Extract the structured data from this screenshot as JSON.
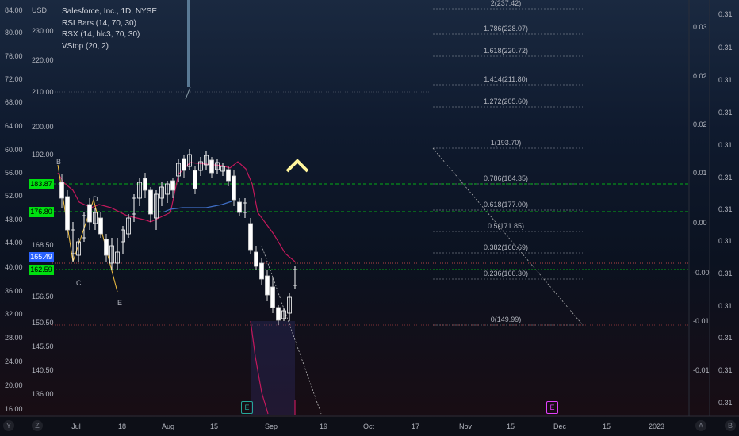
{
  "header": {
    "currency": "USD"
  },
  "legend": {
    "title": "Salesforce, Inc., 1D, NYSE",
    "indicators": [
      "RSI Bars (14, 70, 30)",
      "RSX (14, hlc3, 70, 30)",
      "VStop (20, 2)"
    ]
  },
  "left_scale": [
    "84.00",
    "80.00",
    "76.00",
    "72.00",
    "68.00",
    "64.00",
    "60.00",
    "56.00",
    "52.00",
    "48.00",
    "44.00",
    "40.00",
    "36.00",
    "32.00",
    "28.00",
    "24.00",
    "20.00",
    "16.00"
  ],
  "price_scale": [
    "230.00",
    "220.00",
    "210.00",
    "200.00",
    "192.00",
    "168.50",
    "156.50",
    "150.50",
    "145.50",
    "140.50",
    "136.00"
  ],
  "price_tags": [
    {
      "label": "183.87",
      "style": "green"
    },
    {
      "label": "176.80",
      "style": "green"
    },
    {
      "label": "165.49",
      "style": "blue"
    },
    {
      "label": "162.59",
      "style": "green"
    }
  ],
  "right_inner_scale": [
    "0.03",
    "0.02",
    "0.02",
    "0.01",
    "0.00",
    "-0.00",
    "-0.01",
    "-0.01"
  ],
  "right_outer_scale": [
    "0.31",
    "0.31",
    "0.31",
    "0.31",
    "0.31",
    "0.31",
    "0.31",
    "0.31",
    "0.31",
    "0.31",
    "0.31",
    "0.31",
    "0.31"
  ],
  "fib_levels": [
    "2(237.42)",
    "1.786(228.07)",
    "1.618(220.72)",
    "1.414(211.80)",
    "1.272(205.60)",
    "1(193.70)",
    "0.786(184.35)",
    "0.618(177.00)",
    "0.5(171.85)",
    "0.382(166.69)",
    "0.236(160.30)",
    "0(149.99)"
  ],
  "wave_labels": [
    "B",
    "D",
    "C",
    "E"
  ],
  "time_axis": [
    "Jul",
    "18",
    "Aug",
    "15",
    "Sep",
    "19",
    "Oct",
    "17",
    "Nov",
    "15",
    "Dec",
    "15",
    "2023"
  ],
  "events": [
    {
      "label": "E",
      "color": "#26a69a"
    },
    {
      "label": "E",
      "color": "#e040fb"
    }
  ],
  "corner": {
    "y_label": "Y",
    "z_label": "Z",
    "a_label": "A",
    "b_label": "B"
  },
  "colors": {
    "fib": "#d1d4dc",
    "green_tag": "#00e010",
    "blue_tag": "#2962ff",
    "vstop": "#c2185b",
    "wave": "#f5c342"
  }
}
